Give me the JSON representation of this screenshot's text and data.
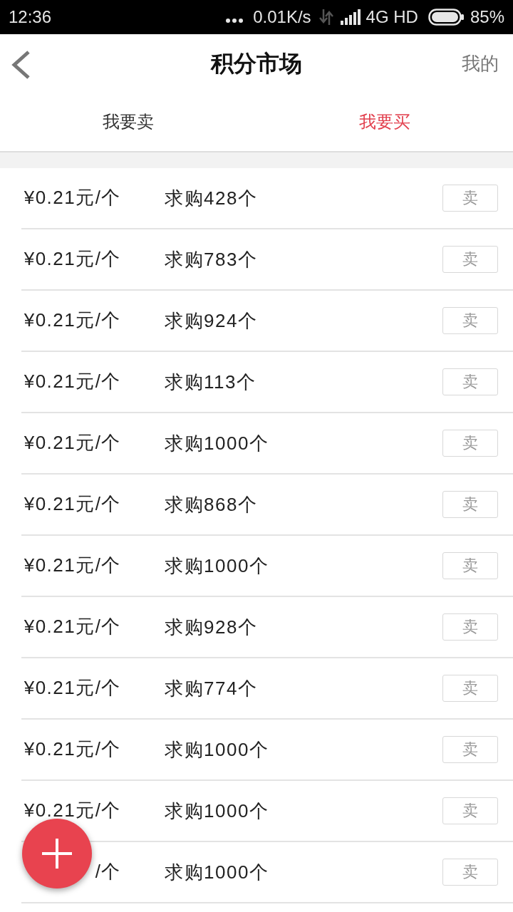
{
  "status_bar": {
    "time": "12:36",
    "speed": "0.01K/s",
    "network": "4G HD",
    "battery": "85%"
  },
  "header": {
    "title": "积分市场",
    "action": "我的"
  },
  "tabs": [
    {
      "label": "我要卖",
      "selected": false
    },
    {
      "label": "我要买",
      "selected": true
    }
  ],
  "rows": [
    {
      "price": "¥0.21元/个",
      "quantity": "求购428个",
      "button": "卖"
    },
    {
      "price": "¥0.21元/个",
      "quantity": "求购783个",
      "button": "卖"
    },
    {
      "price": "¥0.21元/个",
      "quantity": "求购924个",
      "button": "卖"
    },
    {
      "price": "¥0.21元/个",
      "quantity": "求购113个",
      "button": "卖"
    },
    {
      "price": "¥0.21元/个",
      "quantity": "求购1000个",
      "button": "卖"
    },
    {
      "price": "¥0.21元/个",
      "quantity": "求购868个",
      "button": "卖"
    },
    {
      "price": "¥0.21元/个",
      "quantity": "求购1000个",
      "button": "卖"
    },
    {
      "price": "¥0.21元/个",
      "quantity": "求购928个",
      "button": "卖"
    },
    {
      "price": "¥0.21元/个",
      "quantity": "求购774个",
      "button": "卖"
    },
    {
      "price": "¥0.21元/个",
      "quantity": "求购1000个",
      "button": "卖"
    },
    {
      "price": "¥0.21元/个",
      "quantity": "求购1000个",
      "button": "卖"
    },
    {
      "price": "/个",
      "quantity": "求购1000个",
      "button": "卖"
    }
  ]
}
